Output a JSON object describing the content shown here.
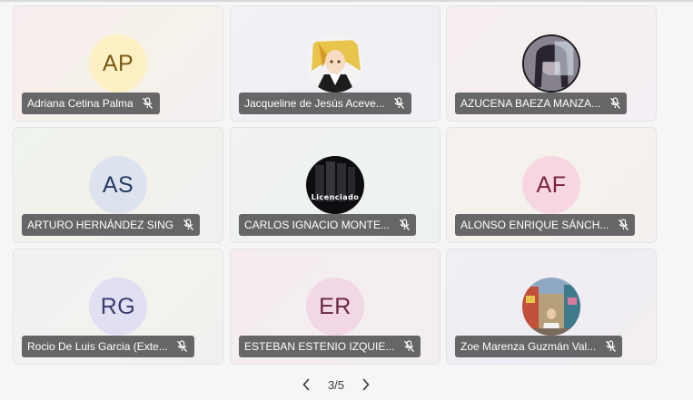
{
  "participants": [
    {
      "name": "Adriana Cetina Palma",
      "initials": "AP",
      "avatar_type": "initials",
      "avatar_bg": "#fdf0c4",
      "avatar_fg": "#7a5a12",
      "tile_bg": "linear-gradient(135deg,#f7ecee 0%,#f6f1ea 55%,#f3f0f2 100%)",
      "muted": true
    },
    {
      "name": "Jacqueline de Jesús Aceve...",
      "initials": "",
      "avatar_type": "photo-anime",
      "tile_bg": "linear-gradient(135deg,#f1f1f6 0%,#efeff4 60%,#f2f0f4 100%)",
      "muted": true
    },
    {
      "name": "AZUCENA BAEZA MANZA...",
      "initials": "",
      "avatar_type": "photo-person",
      "tile_bg": "linear-gradient(135deg,#f6eeee 0%,#f4eff2 60%,#f3eff4 100%)",
      "muted": true
    },
    {
      "name": "ARTURO HERNÁNDEZ SING",
      "initials": "AS",
      "avatar_type": "initials",
      "avatar_bg": "#dde3ee",
      "avatar_fg": "#243a63",
      "tile_bg": "linear-gradient(135deg,#eef4ec 0%,#f3f1ec 55%,#f1eff0 100%)",
      "muted": true
    },
    {
      "name": "CARLOS IGNACIO MONTE...",
      "initials": "",
      "avatar_type": "photo-suits",
      "avatar_caption": "Licenciado",
      "tile_bg": "linear-gradient(135deg,#f1f2f2 0%,#eef2f2 60%,#edf1f1 100%)",
      "muted": true
    },
    {
      "name": "ALONSO ENRIQUE SÁNCH...",
      "initials": "AF",
      "avatar_type": "initials",
      "avatar_bg": "#f5d6e1",
      "avatar_fg": "#7a2340",
      "tile_bg": "linear-gradient(135deg,#f6f1ee 0%,#f5f1ec 55%,#f4f0ef 100%)",
      "muted": true
    },
    {
      "name": "Rocio De Luis Garcia (Exte...",
      "initials": "RG",
      "avatar_type": "initials",
      "avatar_bg": "#e1e0f3",
      "avatar_fg": "#3b3a6e",
      "tile_bg": "linear-gradient(135deg,#eff1f3 0%,#f3f2ee 55%,#f2f0ef 100%)",
      "muted": true
    },
    {
      "name": "ESTEBAN ESTENIO IZQUIE...",
      "initials": "ER",
      "avatar_type": "initials",
      "avatar_bg": "#f2d7e4",
      "avatar_fg": "#6a2446",
      "tile_bg": "linear-gradient(135deg,#f5ebf0 0%,#f4eef1 55%,#f2eef2 100%)",
      "muted": true
    },
    {
      "name": "Zoe Marenza Guzmán Val...",
      "initials": "",
      "avatar_type": "photo-street",
      "tile_bg": "linear-gradient(135deg,#f1eef4 0%,#efedf3 55%,#f3eef2 100%)",
      "muted": true
    }
  ],
  "pagination": {
    "label": "3/5",
    "prev_icon": "chevron-left-icon",
    "next_icon": "chevron-right-icon"
  },
  "icons": {
    "muted_mic": "mic-off-icon"
  }
}
